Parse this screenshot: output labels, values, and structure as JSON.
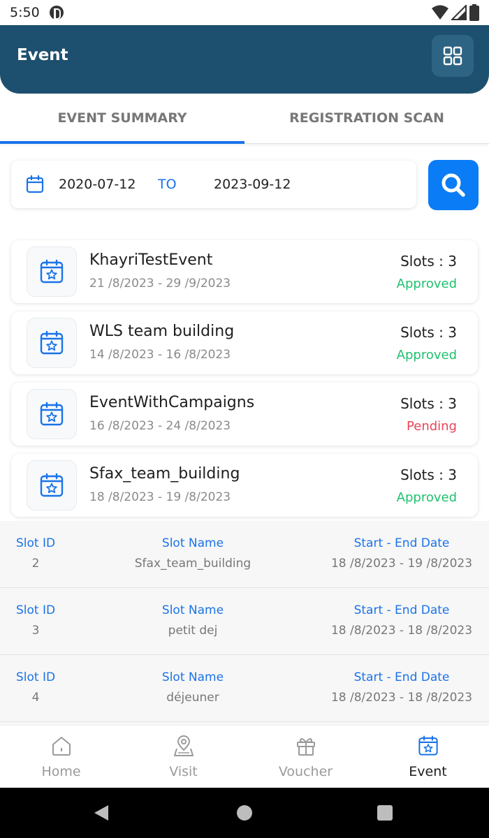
{
  "status_bar": {
    "time": "5:50"
  },
  "header": {
    "title": "Event",
    "grid_icon": "grid-icon"
  },
  "tabs": [
    {
      "label": "EVENT SUMMARY",
      "active": true
    },
    {
      "label": "REGISTRATION SCAN",
      "active": false
    }
  ],
  "date_range": {
    "from": "2020-07-12",
    "to_label": "TO",
    "to": "2023-09-12"
  },
  "search": {
    "icon": "search-icon"
  },
  "events": [
    {
      "name": "KhayriTestEvent",
      "dates": "21 /8/2023 - 29 /9/2023",
      "slots": "Slots : 3",
      "status": "Approved",
      "status_color": "#1ec26f"
    },
    {
      "name": "WLS team building",
      "dates": "14 /8/2023 - 16 /8/2023",
      "slots": "Slots : 3",
      "status": "Approved",
      "status_color": "#1ec26f"
    },
    {
      "name": "EventWithCampaigns",
      "dates": "16 /8/2023 - 24 /8/2023",
      "slots": "Slots : 3",
      "status": "Pending",
      "status_color": "#e8455a"
    },
    {
      "name": "Sfax_team_building",
      "dates": "18 /8/2023 - 19 /8/2023",
      "slots": "Slots : 3",
      "status": "Approved",
      "status_color": "#1ec26f"
    }
  ],
  "slot_headers": {
    "id": "Slot ID",
    "name": "Slot Name",
    "dates": "Start - End Date"
  },
  "slots": [
    {
      "id": "2",
      "name": "Sfax_team_building",
      "dates": "18 /8/2023 - 19 /8/2023"
    },
    {
      "id": "3",
      "name": "petit dej",
      "dates": "18 /8/2023 - 18 /8/2023"
    },
    {
      "id": "4",
      "name": "déjeuner",
      "dates": "18 /8/2023 - 18 /8/2023"
    }
  ],
  "bottom_nav": [
    {
      "label": "Home",
      "icon": "home-icon",
      "active": false
    },
    {
      "label": "Visit",
      "icon": "map-pin-icon",
      "active": false
    },
    {
      "label": "Voucher",
      "icon": "gift-icon",
      "active": false
    },
    {
      "label": "Event",
      "icon": "calendar-star-icon",
      "active": true
    }
  ],
  "colors": {
    "header": "#1d4f6e",
    "accent": "#1a73e8",
    "search_button": "#0a7cf5",
    "approved": "#1ec26f",
    "pending": "#e8455a"
  }
}
